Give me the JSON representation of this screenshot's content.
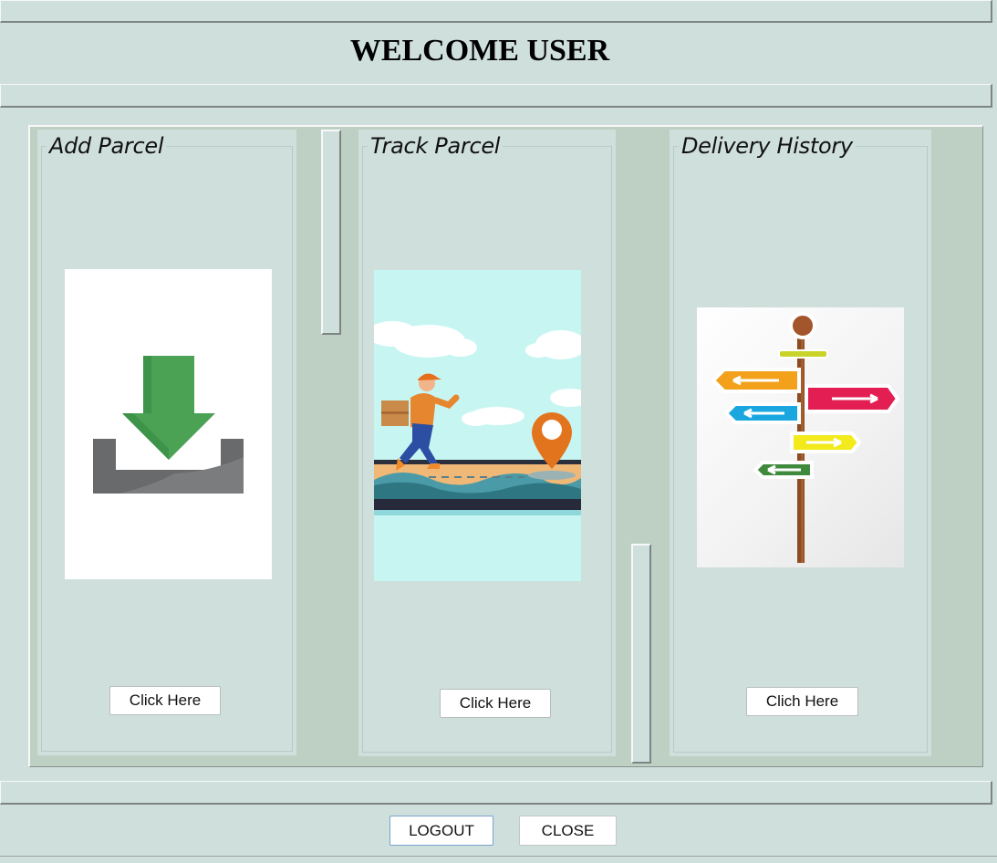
{
  "header": {
    "title": "WELCOME USER"
  },
  "panels": [
    {
      "title": "Add Parcel",
      "button_label": "Click Here",
      "icon": "download-tray-icon"
    },
    {
      "title": "Track Parcel",
      "button_label": "Click Here",
      "icon": "delivery-runner-map-illustration"
    },
    {
      "title": "Delivery History",
      "button_label": "Clich Here",
      "icon": "direction-signpost-illustration"
    }
  ],
  "footer": {
    "logout_label": "LOGOUT",
    "close_label": "CLOSE"
  },
  "colors": {
    "background": "#cfdfdc",
    "outer_panel": "#bed0c3",
    "button_bg": "#ffffff"
  }
}
